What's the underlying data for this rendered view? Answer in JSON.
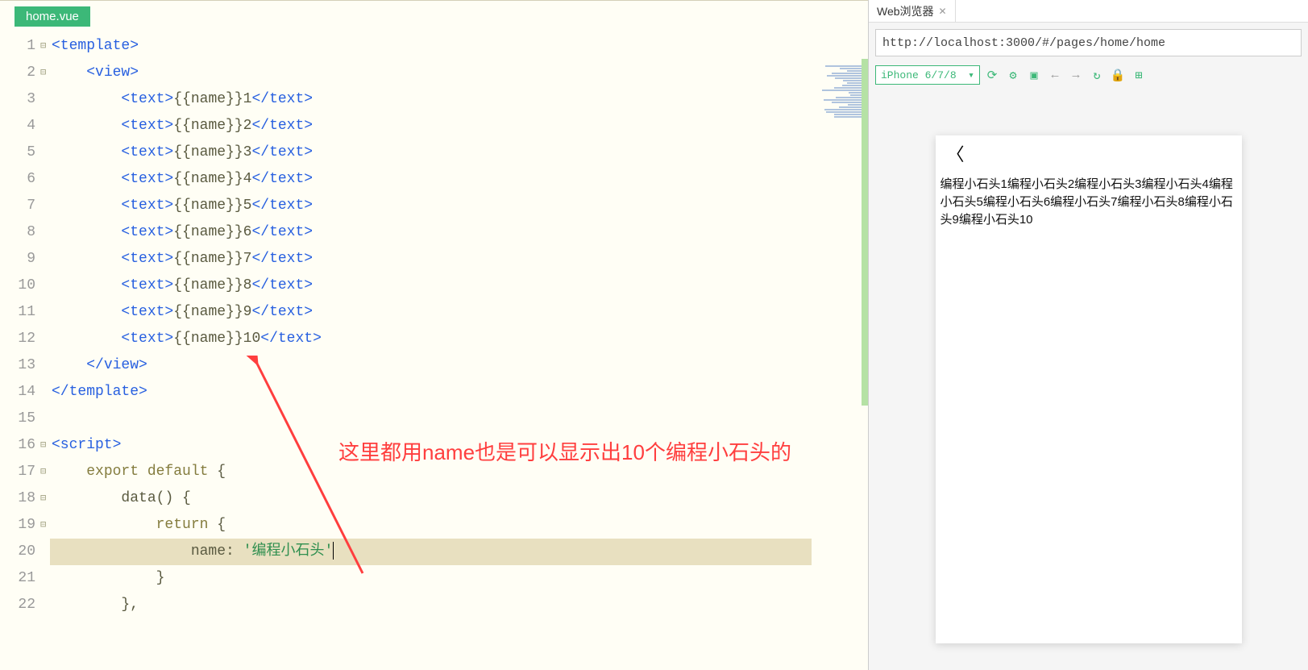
{
  "editor": {
    "tab_filename": "home.vue",
    "line_count": 22,
    "fold_rows": [
      1,
      2,
      16,
      17,
      18,
      19
    ],
    "code_lines": [
      {
        "indent": 0,
        "raw": "<template>",
        "cls": "tag"
      },
      {
        "indent": 1,
        "raw": "<view>",
        "cls": "tag"
      },
      {
        "indent": 2,
        "open": "<text>",
        "close": "</text>",
        "expr": "{{name}}",
        "suffix": "1"
      },
      {
        "indent": 2,
        "open": "<text>",
        "close": "</text>",
        "expr": "{{name}}",
        "suffix": "2"
      },
      {
        "indent": 2,
        "open": "<text>",
        "close": "</text>",
        "expr": "{{name}}",
        "suffix": "3"
      },
      {
        "indent": 2,
        "open": "<text>",
        "close": "</text>",
        "expr": "{{name}}",
        "suffix": "4"
      },
      {
        "indent": 2,
        "open": "<text>",
        "close": "</text>",
        "expr": "{{name}}",
        "suffix": "5"
      },
      {
        "indent": 2,
        "open": "<text>",
        "close": "</text>",
        "expr": "{{name}}",
        "suffix": "6"
      },
      {
        "indent": 2,
        "open": "<text>",
        "close": "</text>",
        "expr": "{{name}}",
        "suffix": "7"
      },
      {
        "indent": 2,
        "open": "<text>",
        "close": "</text>",
        "expr": "{{name}}",
        "suffix": "8"
      },
      {
        "indent": 2,
        "open": "<text>",
        "close": "</text>",
        "expr": "{{name}}",
        "suffix": "9"
      },
      {
        "indent": 2,
        "open": "<text>",
        "close": "</text>",
        "expr": "{{name}}",
        "suffix": "10"
      },
      {
        "indent": 1,
        "raw": "</view>",
        "cls": "tag"
      },
      {
        "indent": 0,
        "raw": "</template>",
        "cls": "tag"
      },
      {
        "indent": 0,
        "raw": "",
        "cls": ""
      },
      {
        "indent": 0,
        "raw": "<script>",
        "cls": "tag"
      },
      {
        "indent": 1,
        "kw": "export default",
        "punct": " {"
      },
      {
        "indent": 2,
        "fn": "data",
        "punct": "() {"
      },
      {
        "indent": 3,
        "kw": "return",
        "punct": " {"
      },
      {
        "indent": 4,
        "prop": "name",
        "colon": ": ",
        "str": "'编程小石头'",
        "current": true
      },
      {
        "indent": 3,
        "punct": "}"
      },
      {
        "indent": 2,
        "punct": "},"
      }
    ],
    "annotation_text": "这里都用name也是可以显示出10个编程小石头的"
  },
  "browser": {
    "tab_title": "Web浏览器",
    "url": "http://localhost:3000/#/pages/home/home",
    "device": "iPhone 6/7/8",
    "preview_text": "编程小石头1编程小石头2编程小石头3编程小石头4编程小石头5编程小石头6编程小石头7编程小石头8编程小石头9编程小石头10"
  }
}
